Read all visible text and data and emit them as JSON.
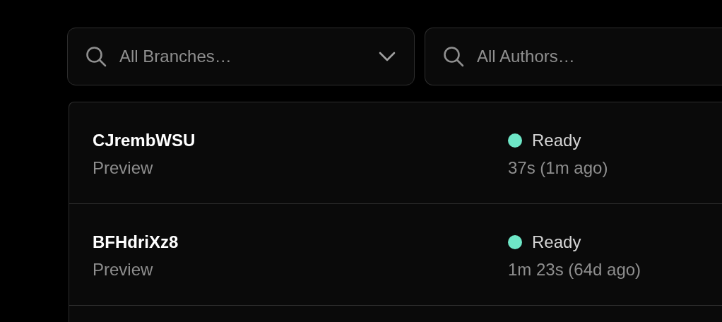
{
  "filters": [
    {
      "kind": "dropdown",
      "placeholder": "All Branches…"
    },
    {
      "kind": "search",
      "placeholder": "All Authors…"
    }
  ],
  "deployments": [
    {
      "name": "CJrembWSU",
      "environment": "Preview",
      "status": "Ready",
      "color": "#6ee7c7",
      "duration": "37s (1m ago)"
    },
    {
      "name": "BFHdriXz8",
      "environment": "Preview",
      "status": "Ready",
      "color": "#6ee7c7",
      "duration": "1m 23s (64d ago)"
    }
  ]
}
